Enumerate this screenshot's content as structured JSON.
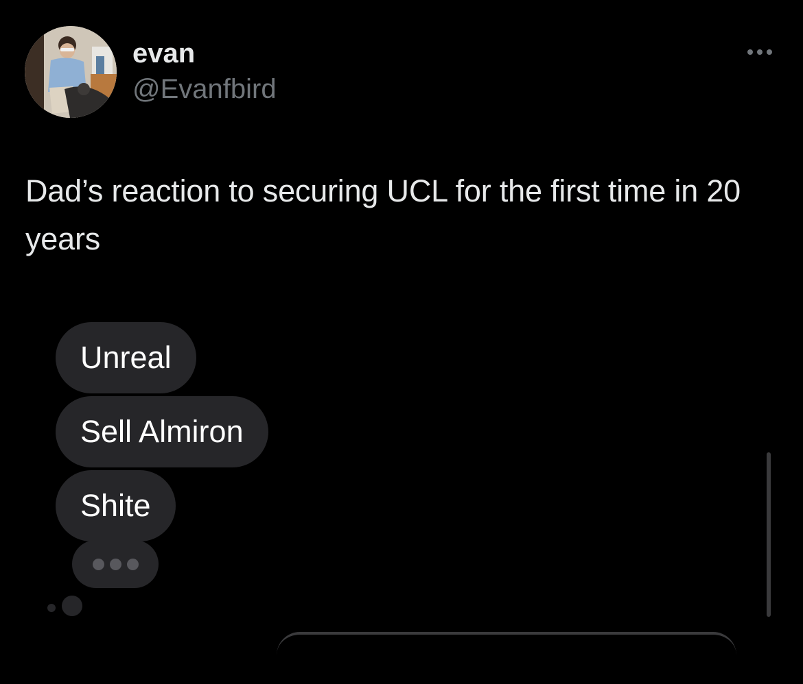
{
  "author": {
    "display_name": "evan",
    "handle": "@Evanfbird",
    "avatar_icon": "profile-photo"
  },
  "tweet": {
    "text": "Dad’s reaction to securing UCL for the first time in 20 years"
  },
  "media": {
    "messages": [
      {
        "text": "Unreal"
      },
      {
        "text": "Sell Almiron"
      },
      {
        "text": "Shite"
      }
    ],
    "typing_indicator_icon": "typing-dots-icon"
  },
  "colors": {
    "background": "#000000",
    "primary_text": "#e7e9ea",
    "secondary_text": "#71767b",
    "bubble": "#262629"
  },
  "icons": {
    "more": "more-horizontal-icon"
  }
}
